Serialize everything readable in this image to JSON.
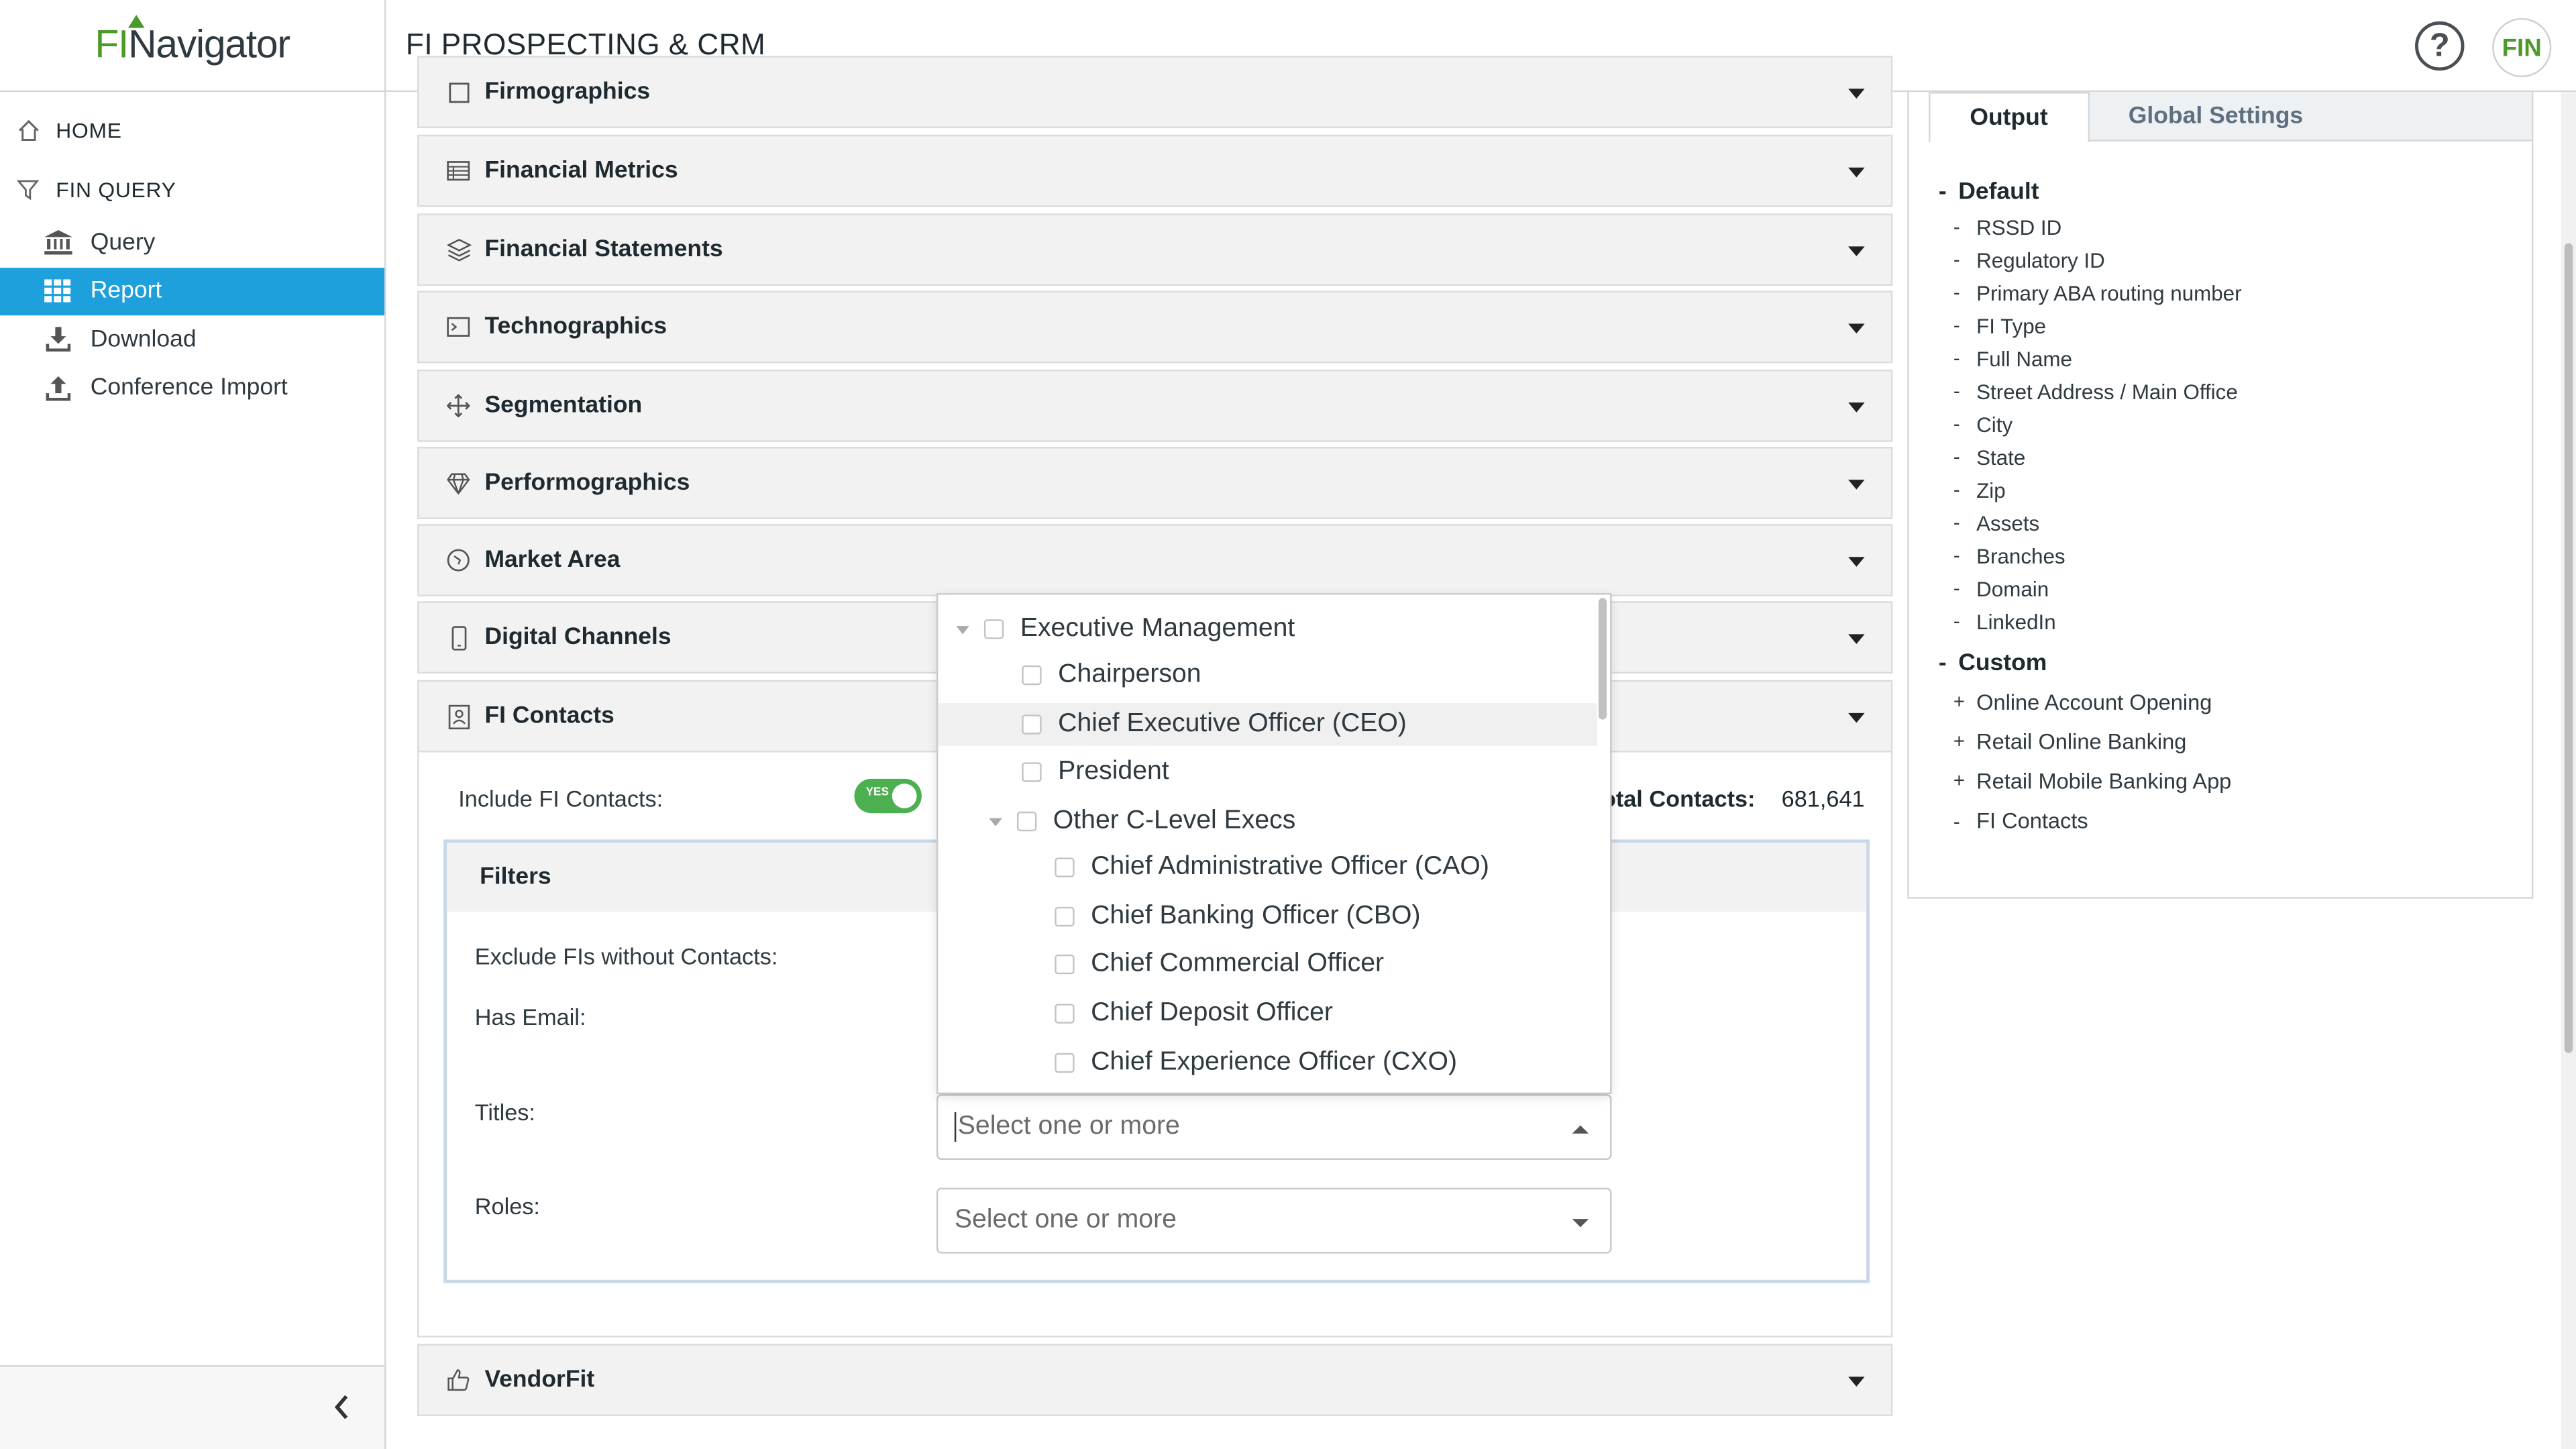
{
  "app": {
    "logo_fi": "FI",
    "logo_rest": "Navigator",
    "page_title": "FI PROSPECTING & CRM",
    "help_label": "?",
    "avatar_text": "FIN"
  },
  "sidebar": {
    "sections": [
      {
        "label": "HOME",
        "icon": "home-icon"
      },
      {
        "label": "FIN QUERY",
        "icon": "filter-icon"
      }
    ],
    "items": [
      {
        "label": "Query",
        "icon": "bank-icon",
        "active": false
      },
      {
        "label": "Report",
        "icon": "grid-icon",
        "active": true
      },
      {
        "label": "Download",
        "icon": "download-icon",
        "active": false
      },
      {
        "label": "Conference Import",
        "icon": "upload-icon",
        "active": false
      }
    ]
  },
  "accordion": [
    {
      "label": "Firmographics",
      "icon": "building-icon"
    },
    {
      "label": "Financial Metrics",
      "icon": "table-icon"
    },
    {
      "label": "Financial Statements",
      "icon": "layers-icon"
    },
    {
      "label": "Technographics",
      "icon": "terminal-icon"
    },
    {
      "label": "Segmentation",
      "icon": "move-icon"
    },
    {
      "label": "Performographics",
      "icon": "diamond-icon"
    },
    {
      "label": "Market Area",
      "icon": "compass-icon"
    },
    {
      "label": "Digital Channels",
      "icon": "mobile-icon"
    },
    {
      "label": "FI Contacts",
      "icon": "contact-card-icon"
    },
    {
      "label": "VendorFit",
      "icon": "thumbs-up-icon"
    }
  ],
  "fi_contacts": {
    "include_label": "Include FI Contacts:",
    "toggle_text": "YES",
    "total_label": "Total Contacts:",
    "total_value": "681,641",
    "filters_title": "Filters",
    "exclude_label": "Exclude FIs without Contacts:",
    "has_email_label": "Has Email:",
    "titles_label": "Titles:",
    "roles_label": "Roles:",
    "titles_placeholder": "Select one or more",
    "roles_placeholder": "Select one or more"
  },
  "titles_tree": [
    {
      "label": "Executive Management",
      "level": 0,
      "expanded": true
    },
    {
      "label": "Chairperson",
      "level": 1
    },
    {
      "label": "Chief Executive Officer (CEO)",
      "level": 1,
      "highlighted": true
    },
    {
      "label": "President",
      "level": 1
    },
    {
      "label": "Other C-Level Execs",
      "level": 1,
      "expanded": true
    },
    {
      "label": "Chief Administrative Officer (CAO)",
      "level": 2
    },
    {
      "label": "Chief Banking Officer (CBO)",
      "level": 2
    },
    {
      "label": "Chief Commercial Officer",
      "level": 2
    },
    {
      "label": "Chief Deposit Officer",
      "level": 2
    },
    {
      "label": "Chief Experience Officer (CXO)",
      "level": 2
    }
  ],
  "right_panel": {
    "tabs": [
      "Output",
      "Global Settings"
    ],
    "default_title": "Default",
    "default_items": [
      "RSSD ID",
      "Regulatory ID",
      "Primary ABA routing number",
      "FI Type",
      "Full Name",
      "Street Address / Main Office",
      "City",
      "State",
      "Zip",
      "Assets",
      "Branches",
      "Domain",
      "LinkedIn"
    ],
    "custom_title": "Custom",
    "custom_items": [
      {
        "label": "Online Account Opening",
        "marker": "+"
      },
      {
        "label": "Retail Online Banking",
        "marker": "+"
      },
      {
        "label": "Retail Mobile Banking App",
        "marker": "+"
      },
      {
        "label": "FI Contacts",
        "marker": "-"
      }
    ]
  },
  "colors": {
    "accent": "#1ea0dc",
    "brand_green": "#4c9a2a",
    "toggle_on": "#4caf50"
  }
}
